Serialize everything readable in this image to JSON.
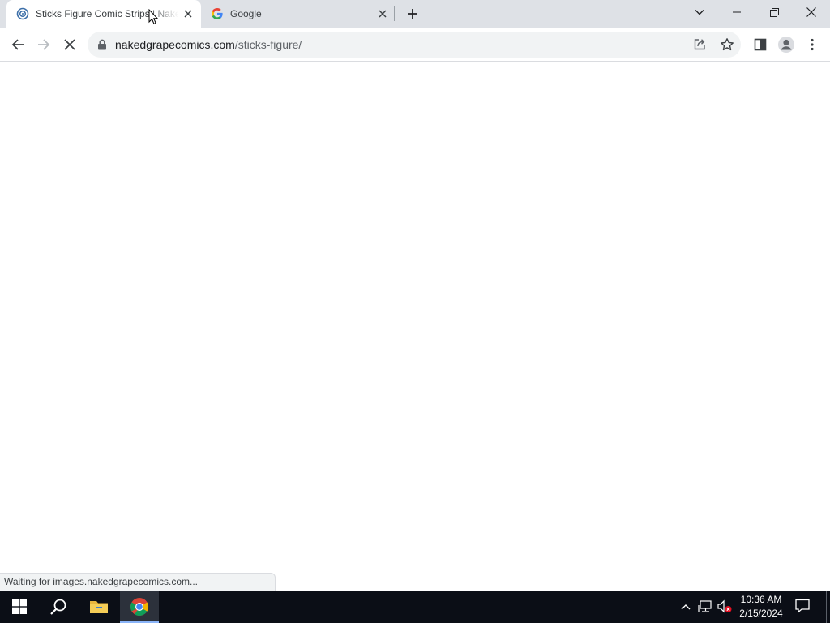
{
  "tabs": [
    {
      "title": "Sticks Figure Comic Strips | Naked Grape Comics",
      "favicon": "site-favicon-icon",
      "active": true
    },
    {
      "title": "Google",
      "favicon": "google-favicon-icon",
      "active": false
    }
  ],
  "address_bar": {
    "domain": "nakedgrapecomics.com",
    "path": "/sticks-figure/"
  },
  "status_bar": {
    "text": "Waiting for images.nakedgrapecomics.com..."
  },
  "taskbar": {
    "time": "10:36 AM",
    "date": "2/15/2024",
    "pinned": [
      "windows-start-icon",
      "search-icon",
      "file-explorer-icon",
      "chrome-icon"
    ]
  },
  "colors": {
    "tabstrip": "#dee1e6",
    "omnibox": "#f1f3f4",
    "taskbar": "#0b0e16",
    "chrome_accent": "#8ab4f8"
  }
}
